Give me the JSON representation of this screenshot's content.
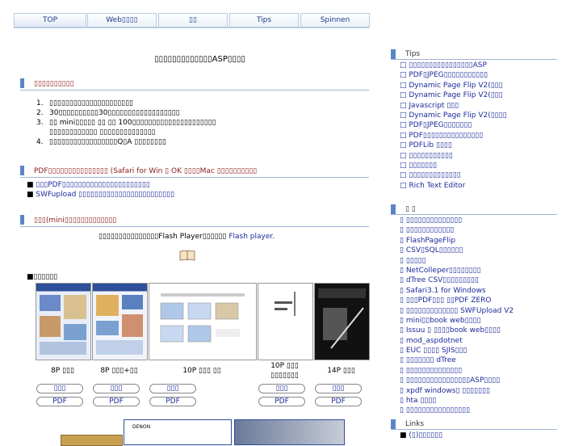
{
  "tabs": [
    "TOP",
    "Web▯▯▯▯",
    "▯▯",
    "Tips",
    "Spinnen"
  ],
  "page_title": "▯▯▯▯▯▯▯▯▯▯▯▯▯ASP▯▯▯▯",
  "section1": {
    "heading": "▯▯▯▯▯▯▯▯▯▯",
    "items": [
      {
        "n": "1.",
        "text": "▯▯▯▯▯▯▯▯▯▯▯▯▯▯▯▯▯▯▯▯▯"
      },
      {
        "n": "2.",
        "text": "30▯▯▯▯▯▯▯▯▯▯30▯▯▯▯▯▯▯▯▯▯▯▯▯▯▯▯▯▯"
      },
      {
        "n": "3.",
        "text": "▯▯ mini▯▯▯▯▯ ▯▯ ▯▯ 100▯▯▯▯▯▯▯▯▯▯▯▯▯▯▯▯▯▯▯▯▯"
      },
      {
        "n": "",
        "text": "▯▯▯▯▯▯▯▯▯▯▯▯ ▯▯▯▯▯▯▯▯▯▯▯▯▯▯"
      },
      {
        "n": "4.",
        "text": "▯▯▯▯▯▯▯▯▯▯▯▯▯▯▯▯▯Q▯A ▯▯▯▯▯▯▯▯"
      }
    ]
  },
  "section2": {
    "heading": "PDF▯▯▯▯▯▯▯▯▯▯▯▯▯▯▯ (Safari for Win ▯ OK ▯▯▯▯Mac ▯▯▯▯▯▯▯▯▯▯",
    "items": [
      "▯▯▯PDF▯▯▯▯▯▯▯▯▯▯▯▯▯▯▯▯▯▯▯▯▯▯",
      "SWFupload ▯▯▯▯▯▯▯▯▯▯▯▯▯▯▯▯▯▯▯▯▯▯▯▯"
    ]
  },
  "section3": {
    "heading": "▯▯▯(mini▯▯▯▯▯▯▯▯▯▯▯▯▯",
    "flash_note": "▯▯▯▯▯▯▯▯▯▯▯▯▯▯▯Flash Player▯▯▯▯▯▯ ",
    "flash_link": "Flash player.",
    "samples_label": "■▯▯▯▯▯▯",
    "thumbs": [
      {
        "cap1": "8P ▯▯▯",
        "cap2": "",
        "btn": "▯▯▯",
        "pdf": "PDF"
      },
      {
        "cap1": "8P ▯▯▯+▯▯",
        "cap2": "",
        "btn": "▯▯▯",
        "pdf": "PDF"
      },
      {
        "cap1": "10P ▯▯▯ ▯▯",
        "cap2": "",
        "btn": "▯▯▯",
        "pdf": "PDF"
      },
      {
        "cap1": "10P ▯▯▯",
        "cap2": "▯▯▯▯▯▯▯",
        "btn": "▯▯▯",
        "pdf": "PDF"
      },
      {
        "cap1": "14P ▯▯▯",
        "cap2": "",
        "btn": "▯▯▯",
        "pdf": "PDF"
      }
    ],
    "bottom_thumb_label": "DENON"
  },
  "sidebar": {
    "tips_title": "Tips",
    "tips": [
      "▯▯▯▯▯▯▯▯▯▯▯▯▯▯▯▯ASP",
      "PDF▯JPEG▯▯▯▯▯▯▯▯▯▯▯",
      "Dynamic Page Flip V2(▯▯▯",
      "Dynamic Page Flip V2(▯▯▯",
      "Javascript ▯▯▯",
      "Dynamic Page Flip V2(▯▯▯▯",
      "PDF▯JPEG▯▯▯▯▯▯▯",
      "PDF▯▯▯▯▯▯▯▯▯▯▯▯▯▯▯",
      "PDFLib ▯▯▯▯",
      "▯▯▯▯▯▯▯▯▯▯▯",
      "▯▯▯▯▯▯▯",
      "▯▯▯▯▯▯▯▯▯▯▯▯▯",
      "Rich Text Editor"
    ],
    "news_title": "▯ ▯",
    "news": [
      "▯▯▯▯▯▯▯▯▯▯▯▯▯▯",
      "▯▯▯▯▯▯▯▯▯▯▯▯",
      "FlashPageFlip",
      "CSV▯SQL▯▯▯▯▯▯",
      "▯▯▯▯▯",
      "NetColleper▯▯▯▯▯▯▯▯",
      "dTree CSV▯▯▯▯▯▯▯▯▯",
      "Safari3.1 for Windows",
      "▯▯▯PDF▯▯▯ ▯▯PDF ZERO",
      "▯▯▯▯▯▯▯▯▯▯▯▯▯ SWFUpload V2",
      "mini▯▯book web▯▯▯▯",
      "Issuu ▯ ▯▯▯▯book web▯▯▯▯",
      "mod_aspdotnet",
      "EUC ▯▯▯▯ SJIS▯▯▯",
      "▯▯▯▯▯▯▯ dTree",
      "▯▯▯▯▯▯▯▯▯▯▯▯▯▯",
      "▯▯▯▯▯▯▯▯▯▯▯▯▯▯▯▯ASP▯▯▯▯",
      "xpdf windows▯ ▯▯▯▯▯▯▯",
      "hta ▯▯▯▯",
      "▯▯▯▯▯▯▯▯▯▯▯▯▯▯▯▯"
    ],
    "links_title": "Links",
    "links": [
      "(▯)▯▯▯▯▯▯"
    ]
  },
  "colors": {
    "accent": "#5b86c4",
    "heading": "#8b1a1a",
    "link": "#1a2a9a"
  }
}
